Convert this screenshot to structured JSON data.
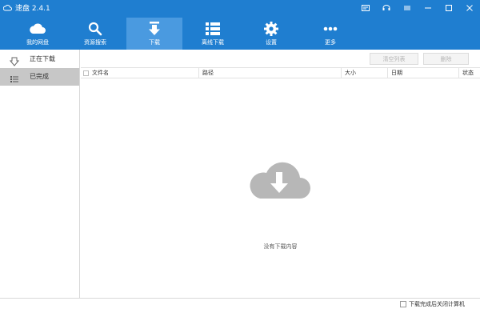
{
  "app": {
    "title": "速盘 2.4.1",
    "icon": "cloud-logo-icon"
  },
  "window_controls": [
    {
      "name": "skin-icon"
    },
    {
      "name": "feedback-icon"
    },
    {
      "name": "settings-menu-icon"
    },
    {
      "name": "minimize-icon"
    },
    {
      "name": "maximize-icon"
    },
    {
      "name": "close-icon"
    }
  ],
  "toolbar": {
    "items": [
      {
        "label": "我的网盘",
        "icon": "cloud-icon",
        "active": false
      },
      {
        "label": "资源搜索",
        "icon": "search-icon",
        "active": false
      },
      {
        "label": "下载",
        "icon": "download-arrow-icon",
        "active": true
      },
      {
        "label": "离线下载",
        "icon": "list-icon",
        "active": false
      },
      {
        "label": "设置",
        "icon": "gear-icon",
        "active": false
      },
      {
        "label": "更多",
        "icon": "more-dots-icon",
        "active": false
      }
    ]
  },
  "sidebar": {
    "items": [
      {
        "label": "正在下载",
        "icon": "downloading-icon",
        "active": false
      },
      {
        "label": "已完成",
        "icon": "completed-list-icon",
        "active": true
      }
    ]
  },
  "actions": {
    "clear_list": "清空列表",
    "delete": "删除"
  },
  "table": {
    "columns": [
      "文件名",
      "路径",
      "大小",
      "日期",
      "状态"
    ]
  },
  "empty_state": {
    "icon": "cloud-download-icon",
    "message": "没有下载内容"
  },
  "status": {
    "checkbox_label": "下载完成后关闭计算机"
  },
  "colors": {
    "brand": "#1f7ed0",
    "active_tab": "#4a9ae0",
    "sidebar_active": "#c7c7c7",
    "empty_icon": "#b7b7b7"
  }
}
